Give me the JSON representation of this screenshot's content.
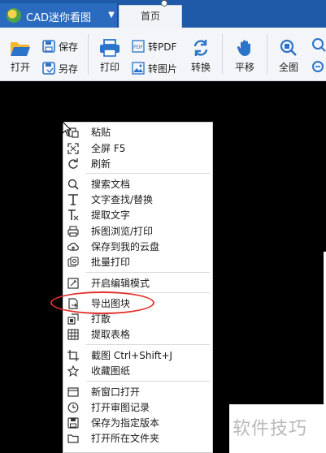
{
  "app": {
    "title": "CAD迷你看图",
    "home_tab": "首页"
  },
  "toolbar": {
    "open": "打开",
    "save": "保存",
    "save_as": "另存",
    "print": "打印",
    "to_pdf": "转PDF",
    "to_image": "转图片",
    "convert": "转换",
    "pan": "平移",
    "full_view": "全图"
  },
  "context_menu": {
    "paste": "粘贴",
    "fullscreen": "全屏 F5",
    "refresh": "刷新",
    "search_doc": "搜索文档",
    "find_replace": "文字查找/替换",
    "extract_text": "提取文字",
    "split_print": "拆图浏览/打印",
    "save_cloud": "保存到我的云盘",
    "batch_print": "批量打印",
    "edit_mode": "开启编辑模式",
    "export_block": "导出图块",
    "explode": "打散",
    "extract_table": "提取表格",
    "screenshot": "截图 Ctrl+Shift+J",
    "favorite": "收藏图纸",
    "new_window": "新窗口打开",
    "review_record": "打开审图记录",
    "save_version": "保存为指定版本",
    "open_folder": "打开所在文件夹"
  },
  "watermark": "软件技巧",
  "colors": {
    "titlebar": "#1e5aa8",
    "toolbar": "#f3f5f8",
    "icon_blue": "#2b73c8",
    "highlight": "#e1332f",
    "canvas": "#000000"
  }
}
